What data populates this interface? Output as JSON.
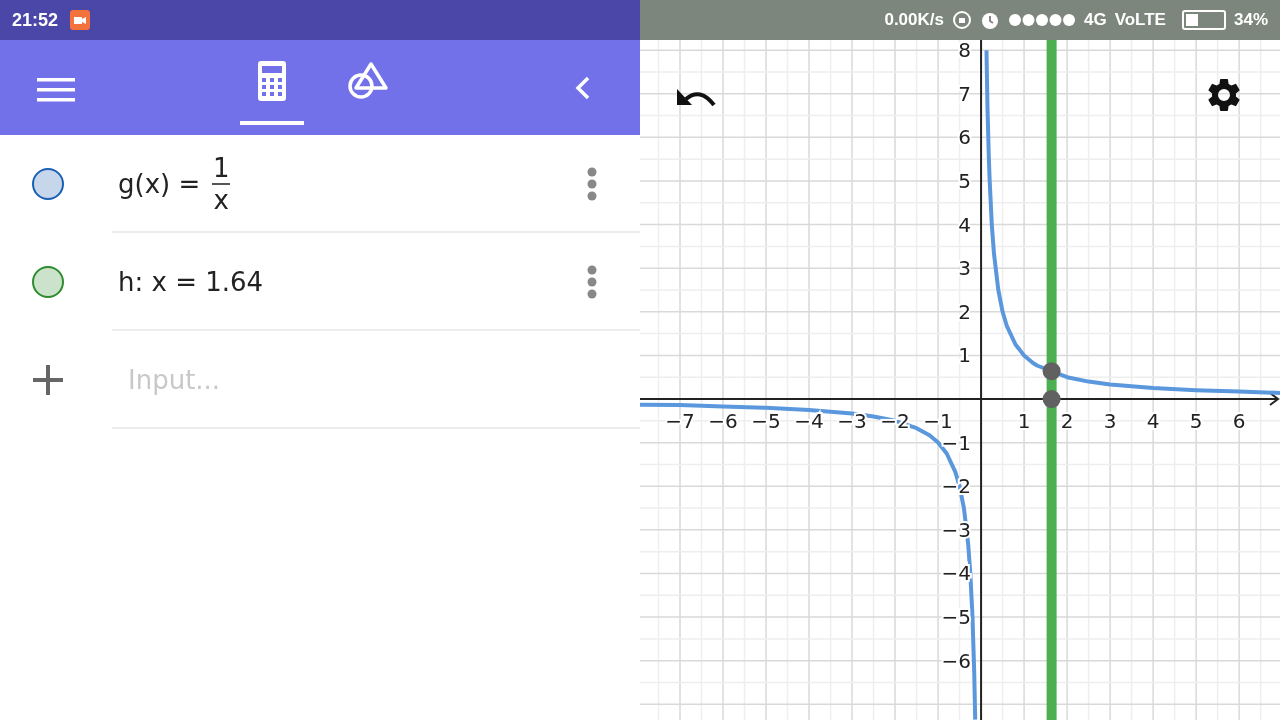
{
  "status_bar": {
    "time": "21:52",
    "speed": "0.00K/s",
    "network": "4G",
    "volte": "VoLTE",
    "battery": "34%"
  },
  "toolbar": {
    "tabs": [
      {
        "kind": "algebra",
        "selected": true
      },
      {
        "kind": "tools",
        "selected": false
      }
    ]
  },
  "algebra_view": {
    "items": [
      {
        "kind": "fraction",
        "lhs": "g(x) =",
        "numerator": "1",
        "denominator": "x",
        "color": "#1a5fb4"
      },
      {
        "kind": "text",
        "text": "h: x = 1.64",
        "color": "#2e8b2e"
      }
    ],
    "input": {
      "placeholder": "Input..."
    }
  },
  "graphics_view": {
    "chart_data": {
      "type": "line",
      "grid": true,
      "xlim": [
        -7.93,
        6.95
      ],
      "ylim": [
        -7.36,
        9.15
      ],
      "xticks": [
        {
          "value": -7,
          "label": "−7"
        },
        {
          "value": -6,
          "label": "−6"
        },
        {
          "value": -5,
          "label": "−5"
        },
        {
          "value": -4,
          "label": "−4"
        },
        {
          "value": -3,
          "label": "−3"
        },
        {
          "value": -2,
          "label": "−2"
        },
        {
          "value": -1,
          "label": "−1"
        },
        1,
        2,
        3,
        4,
        5,
        6
      ],
      "yticks": [
        {
          "value": -6,
          "label": "−6"
        },
        {
          "value": -5,
          "label": "−5"
        },
        {
          "value": -4,
          "label": "−4"
        },
        {
          "value": -3,
          "label": "−3"
        },
        {
          "value": -2,
          "label": "−2"
        },
        {
          "value": -1,
          "label": "−1"
        },
        1,
        2,
        3,
        4,
        5,
        6,
        7,
        8
      ],
      "x": [
        -7.93,
        -7,
        -6,
        -5,
        -4,
        -3,
        -2.5,
        -2,
        -1.5,
        -1.2,
        -1,
        -0.8,
        -0.6,
        -0.5,
        -0.4,
        -0.3,
        -0.25,
        -0.2,
        -0.16,
        -0.136,
        0,
        0.125,
        0.13,
        0.15,
        0.18,
        0.2,
        0.25,
        0.3,
        0.4,
        0.5,
        0.6,
        0.8,
        1,
        1.2,
        1.3,
        2,
        2.5,
        3,
        4,
        5,
        6,
        6.95
      ],
      "series": [
        {
          "color": "#5a97dc",
          "values": [
            -0.13,
            -0.14,
            -0.17,
            -0.2,
            -0.25,
            -0.33,
            -0.4,
            -0.5,
            -0.67,
            -0.83,
            -1,
            -1.25,
            -1.67,
            -2,
            -2.5,
            -3.33,
            -4,
            -5,
            -6.25,
            -7.35,
            null,
            8,
            7.69,
            6.67,
            5.56,
            5,
            4,
            3.33,
            2.5,
            2,
            1.67,
            1.25,
            1,
            0.83,
            0.77,
            0.5,
            0.4,
            0.33,
            0.25,
            0.2,
            0.17,
            0.14
          ]
        }
      ],
      "ref_lines": [
        {
          "axis": "x",
          "value": 1.64,
          "color": "#4caf50"
        }
      ]
    }
  }
}
